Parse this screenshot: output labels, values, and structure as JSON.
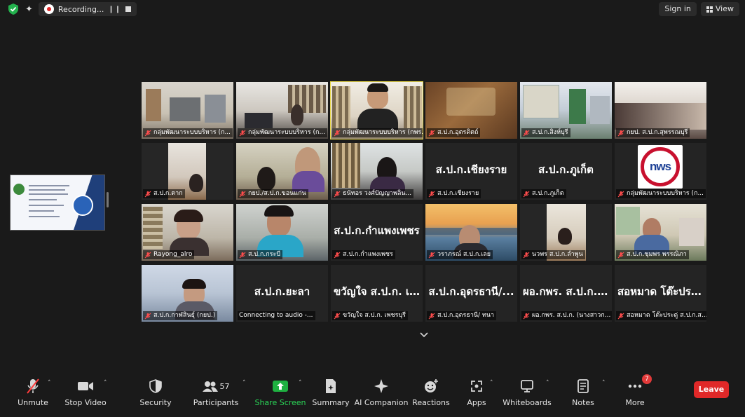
{
  "topbar": {
    "recording_label": "Recording...",
    "sign_in_label": "Sign in",
    "view_label": "View"
  },
  "participants_grid": [
    {
      "name": "กลุ่มพัฒนาระบบบริหาร (ก...",
      "display": ""
    },
    {
      "name": "กลุ่มพัฒนาระบบบริหาร (ก...",
      "display": ""
    },
    {
      "name": "กลุ่มพัฒนาระบบบริหาร (กพร. ...",
      "display": ""
    },
    {
      "name": "ส.ป.ก.อุตรดิตถ์",
      "display": ""
    },
    {
      "name": "ส.ป.ก.สิงห์บุรี",
      "display": ""
    },
    {
      "name": "กยป. ส.ป.ก.สุพรรณบุรี",
      "display": ""
    },
    {
      "name": "ส.ป.ก.ตาก",
      "display": ""
    },
    {
      "name": "กยป./ส.ป.ก.ขอนแก่น",
      "display": ""
    },
    {
      "name": "ธนัทอร วงศ์ปัญญาพลิน...",
      "display": ""
    },
    {
      "name": "ส.ป.ก.เชียงราย",
      "display": "ส.ป.ก.เชียงราย"
    },
    {
      "name": "ส.ป.ก.ภูเก็ต",
      "display": "ส.ป.ก.ภูเก็ต"
    },
    {
      "name": "กลุ่มพัฒนาระบบบริหาร (ก...",
      "display": "",
      "logo_text": "nws"
    },
    {
      "name": "Rayong_alro",
      "display": ""
    },
    {
      "name": "ส.ป.ก.กระบี่",
      "display": ""
    },
    {
      "name": "ส.ป.ก.กำแพงเพชร",
      "display": "ส.ป.ก.กำแพงเพชร"
    },
    {
      "name": "วราภรณ์ ส.ป.ก.เลย",
      "display": ""
    },
    {
      "name": "นวพร ส.ป.ก.ลำพูน",
      "display": ""
    },
    {
      "name": "ส.ป.ก.ชุมพร พรรณิภา",
      "display": ""
    },
    {
      "name": "ส.ป.ก.กาฬสินธุ์ (กยป.)",
      "display": ""
    },
    {
      "name": "Connecting to audio -...",
      "display": "ส.ป.ก.ยะลา"
    },
    {
      "name": "ขวัญใจ ส.ป.ก. เพชรบุรี",
      "display": "ขวัญใจ ส.ป.ก. เพ..."
    },
    {
      "name": "ส.ป.ก.อุดรธานี/ ทนา",
      "display": "ส.ป.ก.อุดรธานี/..."
    },
    {
      "name": "ผอ.กพร. ส.ป.ก. (นางสาวก...",
      "display": "ผอ.กพร. ส.ป.ก. (..."
    },
    {
      "name": "สอหมาด โต๊ะประดู่ ส.ป.ก.ส...",
      "display": "สอหมาด โต๊ะประ..."
    }
  ],
  "toolbar": {
    "unmute": "Unmute",
    "stop_video": "Stop Video",
    "security": "Security",
    "participants": "Participants",
    "participants_count": "57",
    "share_screen": "Share Screen",
    "summary": "Summary",
    "ai_companion": "AI Companion",
    "reactions": "Reactions",
    "apps": "Apps",
    "whiteboards": "Whiteboards",
    "notes": "Notes",
    "more": "More",
    "more_badge": "7",
    "leave": "Leave"
  },
  "colors": {
    "accent_green": "#1fb141",
    "leave_red": "#e02828",
    "active_speaker": "#e8d84a",
    "background": "#1a1a1a"
  }
}
